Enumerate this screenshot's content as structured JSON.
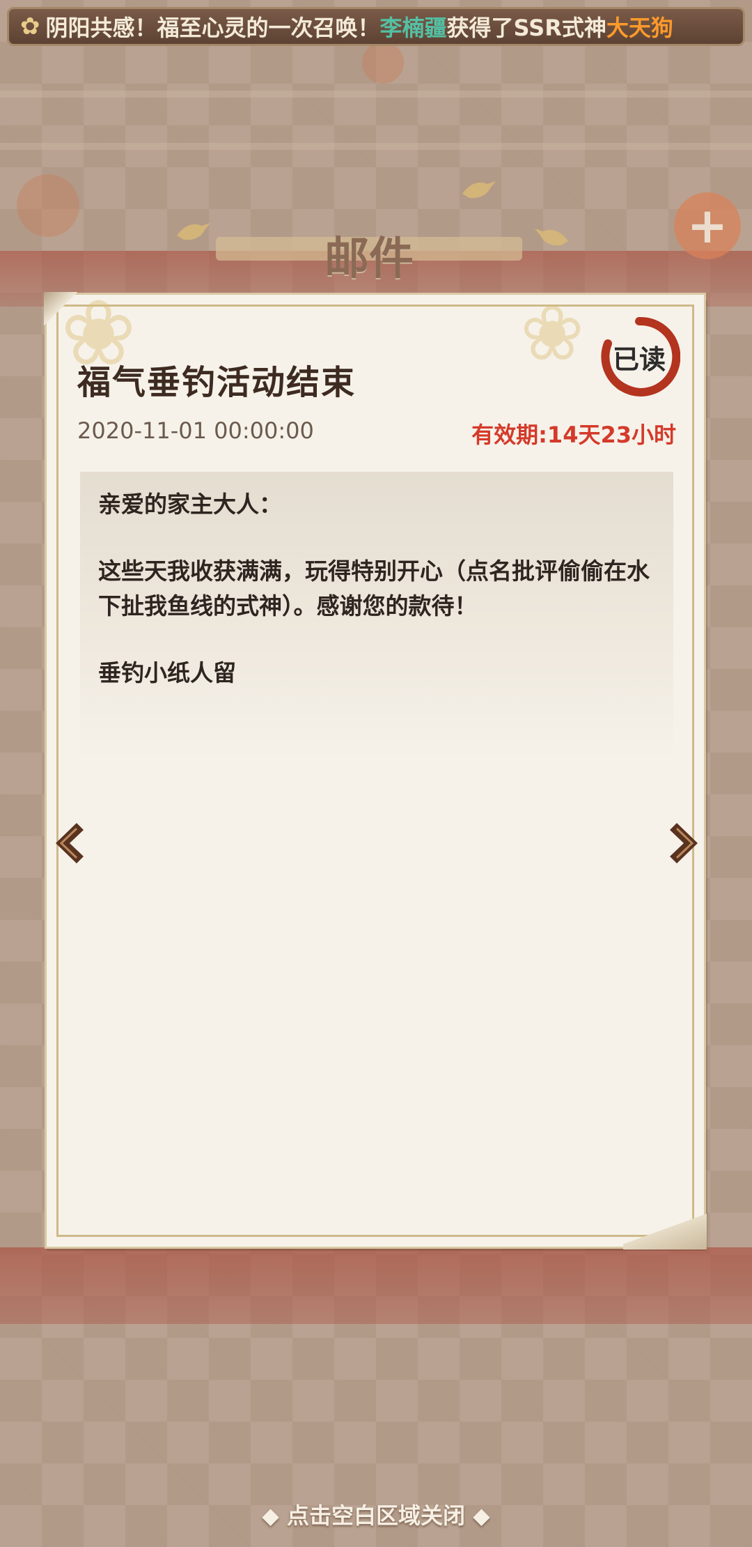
{
  "marquee": {
    "prefix": "阴阳共感！福至心灵的一次召唤！",
    "player_name": "李楠疆",
    "middle": "获得了SSR式神",
    "shikigami": "大天狗"
  },
  "header": {
    "title": "邮件"
  },
  "mail": {
    "title": "福气垂钓活动结束",
    "date": "2020-11-01 00:00:00",
    "validity": "有效期:14天23小时",
    "read_status": "已读",
    "body": {
      "greeting": "亲爱的家主大人：",
      "paragraph": "这些天我收获满满，玩得特别开心（点名批评偷偷在水下扯我鱼线的式神）。感谢您的款待！",
      "signature": "垂钓小纸人留"
    }
  },
  "navigation": {
    "prev_icon": "chevron-left-icon",
    "next_icon": "chevron-right-icon"
  },
  "footer": {
    "close_hint": "◆ 点击空白区域关闭 ◆"
  },
  "colors": {
    "validity": "#d43a2a",
    "player_name": "#54c0a4",
    "shikigami": "#ff9a2b",
    "stamp": "#b3341f"
  }
}
